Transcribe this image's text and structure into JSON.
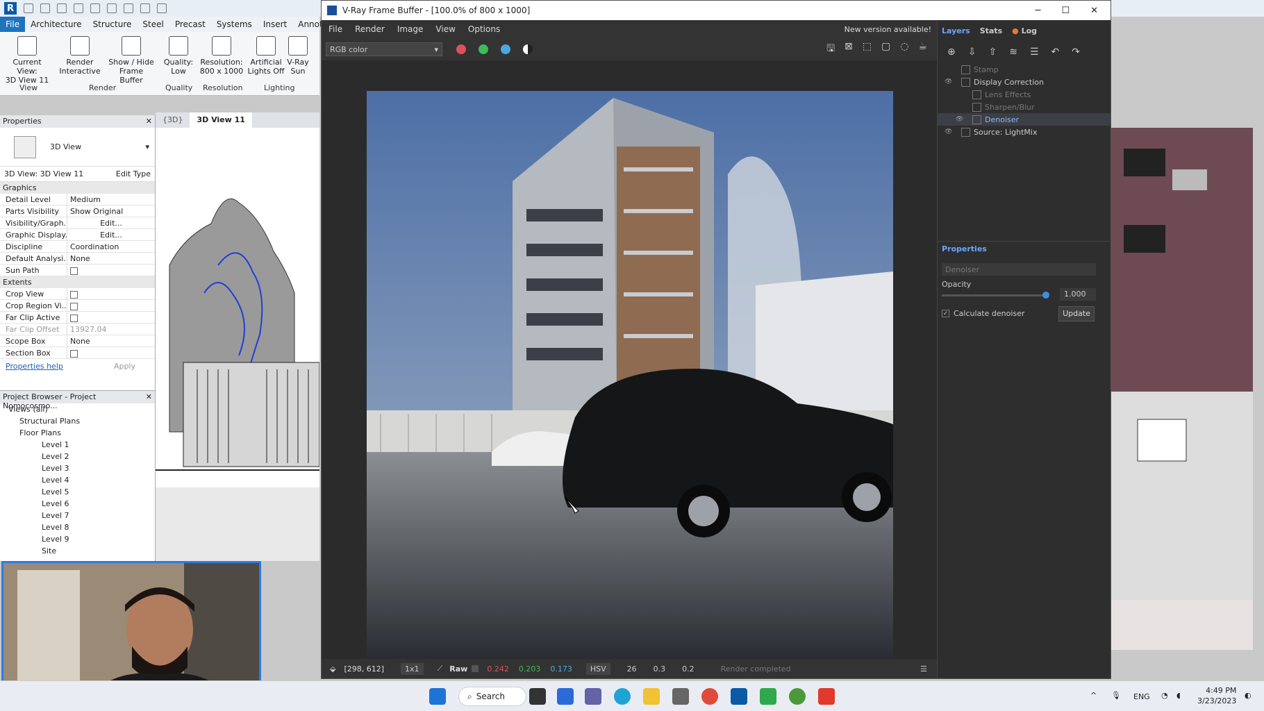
{
  "revit": {
    "tabs": [
      "File",
      "Architecture",
      "Structure",
      "Steel",
      "Precast",
      "Systems",
      "Insert",
      "Annotate"
    ],
    "ribbon_buttons": [
      {
        "line1": "Current View:",
        "line2": "3D View 11"
      },
      {
        "line1": "Render",
        "line2": "Interactive"
      },
      {
        "line1": "Show / Hide",
        "line2": "Frame Buffer"
      },
      {
        "line1": "Quality:",
        "line2": "Low"
      },
      {
        "line1": "Resolution:",
        "line2": "800 x 1000"
      },
      {
        "line1": "Artificial",
        "line2": "Lights Off"
      },
      {
        "line1": "V-Ray",
        "line2": "Sun"
      }
    ],
    "ribbon_groups": [
      "View",
      "Render",
      "Quality",
      "Resolution",
      "Lighting"
    ],
    "properties": {
      "title": "Properties",
      "type_name": "3D View",
      "selector": "3D View: 3D View 11",
      "edit_type": "Edit Type",
      "graphics_label": "Graphics",
      "graphics": [
        {
          "k": "Detail Level",
          "v": "Medium"
        },
        {
          "k": "Parts Visibility",
          "v": "Show Original"
        },
        {
          "k": "Visibility/Graph...",
          "v": "Edit..."
        },
        {
          "k": "Graphic Display...",
          "v": "Edit..."
        },
        {
          "k": "Discipline",
          "v": "Coordination"
        },
        {
          "k": "Default Analysi...",
          "v": "None"
        },
        {
          "k": "Sun Path",
          "v": ""
        }
      ],
      "extents_label": "Extents",
      "extents": [
        {
          "k": "Crop View",
          "v": ""
        },
        {
          "k": "Crop Region Vi...",
          "v": ""
        },
        {
          "k": "Far Clip Active",
          "v": ""
        },
        {
          "k": "Far Clip Offset",
          "v": "13927.04"
        },
        {
          "k": "Scope Box",
          "v": "None"
        },
        {
          "k": "Section Box",
          "v": ""
        }
      ],
      "help": "Properties help",
      "apply": "Apply"
    },
    "browser": {
      "title": "Project Browser - Project Nomocosmo...",
      "items": [
        "Views (all)",
        "Structural Plans",
        "Floor Plans",
        "Level 1",
        "Level 2",
        "Level 3",
        "Level 4",
        "Level 5",
        "Level 6",
        "Level 7",
        "Level 8",
        "Level 9",
        "Site"
      ]
    },
    "view_tabs": [
      "{3D}",
      "3D View 11"
    ]
  },
  "vfb": {
    "title": "V-Ray Frame Buffer - [100.0% of 800 x 1000]",
    "menu": [
      "File",
      "Render",
      "Image",
      "View",
      "Options"
    ],
    "new_version": "New version available!",
    "channel": "RGB color",
    "right_tabs": [
      "Layers",
      "Stats",
      "Log"
    ],
    "layers": [
      {
        "name": "Stamp",
        "state": "dim"
      },
      {
        "name": "Display Correction",
        "state": "normal"
      },
      {
        "name": "Lens Effects",
        "state": "dim"
      },
      {
        "name": "Sharpen/Blur",
        "state": "dim"
      },
      {
        "name": "Denoiser",
        "state": "sel"
      },
      {
        "name": "Source: LightMix",
        "state": "normal"
      }
    ],
    "props_title": "Properties",
    "props_field": "Denoiser",
    "opacity_label": "Opacity",
    "opacity_value": "1.000",
    "calc_denoiser": "Calculate denoiser",
    "update": "Update",
    "status": {
      "coords": "[298, 612]",
      "zoom": "1x1",
      "raw": "Raw",
      "r": "0.242",
      "g": "0.203",
      "b": "0.173",
      "mode": "HSV",
      "h": "26",
      "s": "0.3",
      "v": "0.2",
      "msg": "Render completed"
    },
    "colors": {
      "r": "#e0505a",
      "g": "#3fba5a",
      "b": "#4aa8e0"
    }
  },
  "taskbar": {
    "search": "Search",
    "lang": "ENG",
    "time": "4:49 PM",
    "date": "3/23/2023"
  }
}
